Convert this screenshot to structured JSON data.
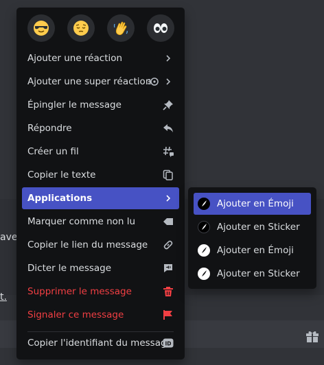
{
  "reactions": [
    {
      "emoji": "😎",
      "name": "sunglasses-emoji"
    },
    {
      "emoji": "😔",
      "name": "pensive-emoji"
    },
    {
      "emoji": "👋",
      "name": "wave-emoji"
    },
    {
      "emoji": "👀",
      "name": "eyes-emoji"
    }
  ],
  "menu": {
    "add_reaction": "Ajouter une réaction",
    "add_super_reaction": "Ajouter une super réaction",
    "pin_message": "Épingler le message",
    "reply": "Répondre",
    "create_thread": "Créer un fil",
    "copy_text": "Copier le texte",
    "applications": "Applications",
    "mark_unread": "Marquer comme non lu",
    "copy_link": "Copier le lien du message",
    "speak_message": "Dicter le message",
    "delete_message": "Supprimer le message",
    "report_message": "Signaler ce message",
    "copy_id": "Copier l'identifiant du message"
  },
  "submenu": {
    "items": [
      {
        "label": "Ajouter en Émoji",
        "active": true
      },
      {
        "label": "Ajouter en Sticker",
        "active": false
      },
      {
        "label": "Ajouter en Émoji",
        "active": false
      },
      {
        "label": "Ajouter en Sticker",
        "active": false
      }
    ]
  },
  "background": {
    "fragment_1": "avec",
    "fragment_2": "t."
  },
  "colors": {
    "menu_bg": "#111214",
    "active": "#4752c4",
    "danger": "#f23f43",
    "app_bg": "#313338"
  }
}
